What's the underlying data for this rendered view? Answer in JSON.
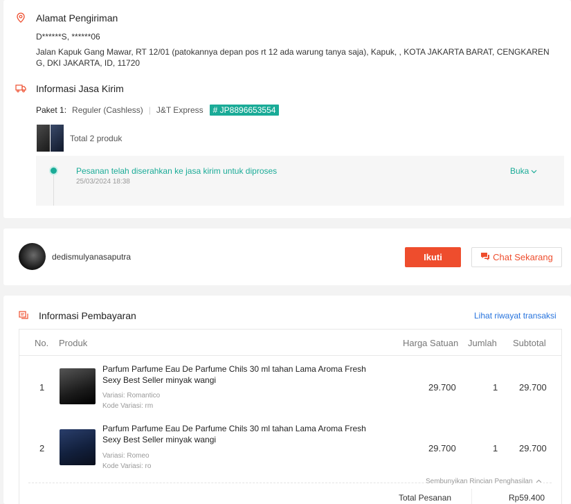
{
  "shipping_address": {
    "title": "Alamat Pengiriman",
    "recipient": "D******S, ******06",
    "address_line1": "Jalan Kapuk Gang Mawar, RT 12/01 (patokannya depan pos rt 12 ada warung tanya saja), Kapuk, , KOTA JAKARTA BARAT, CENGKAREN",
    "address_line2": "G, DKI JAKARTA, ID, 11720"
  },
  "shipping_info": {
    "title": "Informasi Jasa Kirim",
    "package_label": "Paket 1:",
    "service": "Reguler (Cashless)",
    "courier": "J&T Express",
    "tracking_number": "# JP8896653554",
    "total_products": "Total 2 produk",
    "status_text": "Pesanan telah diserahkan ke jasa kirim untuk diproses",
    "status_time": "25/03/2024 18:38",
    "expand_label": "Buka"
  },
  "buyer": {
    "username": "dedismulyanasaputra",
    "follow_label": "Ikuti",
    "chat_label": "Chat Sekarang"
  },
  "payment": {
    "title": "Informasi Pembayaran",
    "history_link": "Lihat riwayat transaksi",
    "columns": [
      "No.",
      "Produk",
      "Harga Satuan",
      "Jumlah",
      "Subtotal"
    ],
    "items": [
      {
        "no": "1",
        "name_line1": "Parfum Parfume Eau De Parfume Chils 30 ml tahan Lama Aroma Fresh",
        "name_line2": "Sexy Best Seller minyak wangi",
        "variation": "Variasi: Romantico",
        "variation_code": "Kode Variasi: rm",
        "unit_price": "29.700",
        "qty": "1",
        "subtotal": "29.700"
      },
      {
        "no": "2",
        "name_line1": "Parfum Parfume Eau De Parfume Chils 30 ml tahan Lama Aroma Fresh",
        "name_line2": "Sexy Best Seller minyak wangi",
        "variation": "Variasi: Romeo",
        "variation_code": "Kode Variasi: ro",
        "unit_price": "29.700",
        "qty": "1",
        "subtotal": "29.700"
      }
    ],
    "hide_details_label": "Sembunyikan Rincian Penghasilan",
    "total_label": "Total Pesanan",
    "total_value": "Rp59.400"
  },
  "colors": {
    "accent": "#ee4d2d",
    "teal": "#1aab97",
    "link": "#2673dd"
  },
  "icons": [
    "location-pin-icon",
    "truck-icon",
    "timeline-dot-icon",
    "chevron-down-icon",
    "chat-icon",
    "payment-icon",
    "chevron-up-icon"
  ]
}
